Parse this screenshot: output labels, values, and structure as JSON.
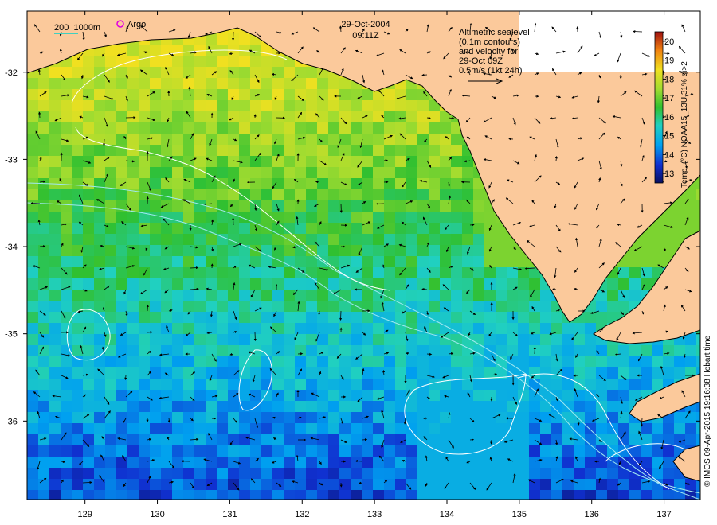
{
  "title": {
    "date": "29-Oct-2004",
    "time": "09:11Z"
  },
  "legend": {
    "scale_label": "200  1000m",
    "argo_label": "Argo",
    "altimetry_lines": [
      "Altimetric sealevel",
      "(0.1m contours)",
      "and velocity for",
      "29-Oct 09Z",
      "0.5m/s (1kt 24h)"
    ]
  },
  "colorbar": {
    "label": "Temp. (°C) NOAA15_13U 31% qi>2",
    "ticks": [
      "20",
      "19",
      "18",
      "17",
      "16",
      "15",
      "14",
      "13"
    ],
    "min": 12.5,
    "max": 20.5
  },
  "axes": {
    "x_ticks": [
      "129",
      "130",
      "131",
      "132",
      "133",
      "134",
      "135",
      "136",
      "137"
    ],
    "y_ticks": [
      "-32",
      "-33",
      "-34",
      "-35",
      "-36"
    ],
    "lon_range": [
      128.2,
      137.5
    ],
    "lat_range": [
      -36.9,
      -31.3
    ]
  },
  "credit": "© IMOS 09-Apr-2015 19:16:38 Hobart time",
  "colors": {
    "land": "#fbc99b",
    "sst_cold": "#0a1a8c",
    "sst_warm": "#f4e21a",
    "contour": "#ffffff",
    "isobath": "#9fe8f0",
    "argo": "#e000e0"
  }
}
